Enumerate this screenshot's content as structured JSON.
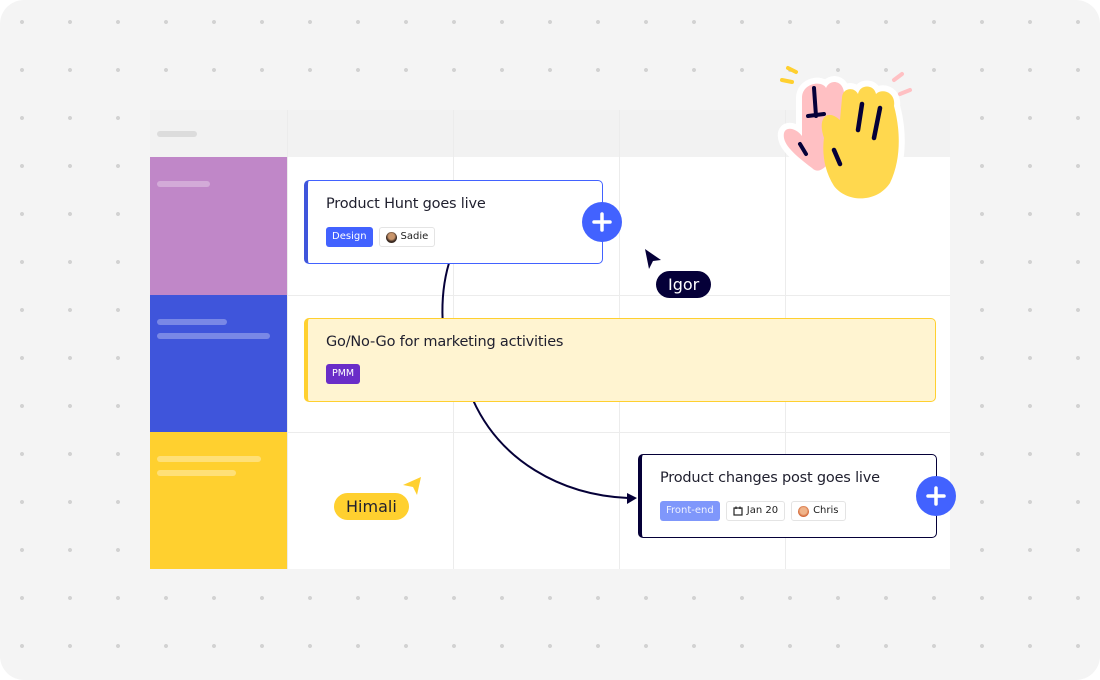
{
  "colors": {
    "canvas_bg": "#f4f4f4",
    "accent_blue": "#4262ff",
    "lane_purple": "#c087c8",
    "lane_blue": "#3f55db",
    "lane_yellow": "#ffd02f",
    "navy": "#050038"
  },
  "swimlanes": [
    {
      "name": "lane-1",
      "color": "#c087c8"
    },
    {
      "name": "lane-2",
      "color": "#3f55db"
    },
    {
      "name": "lane-3",
      "color": "#ffd02f"
    }
  ],
  "cards": [
    {
      "title": "Product Hunt goes live",
      "tags": [
        {
          "label": "Design",
          "color": "#4262ff"
        }
      ],
      "assignee": "Sadie"
    },
    {
      "title": "Go/No-Go for marketing activities",
      "tags": [
        {
          "label": "PMM",
          "color": "#6a2dc8"
        }
      ]
    },
    {
      "title": "Product changes post goes live",
      "tags": [
        {
          "label": "Front-end",
          "color": "#7f97fb"
        }
      ],
      "date": "Jan 20",
      "assignee": "Chris"
    }
  ],
  "cursors": [
    {
      "name": "Igor",
      "color": "#050038"
    },
    {
      "name": "Himali",
      "color": "#ffd02f"
    }
  ],
  "icons": {
    "add": "plus-icon",
    "calendar": "calendar-icon",
    "sticker": "high-five-hands-icon"
  }
}
